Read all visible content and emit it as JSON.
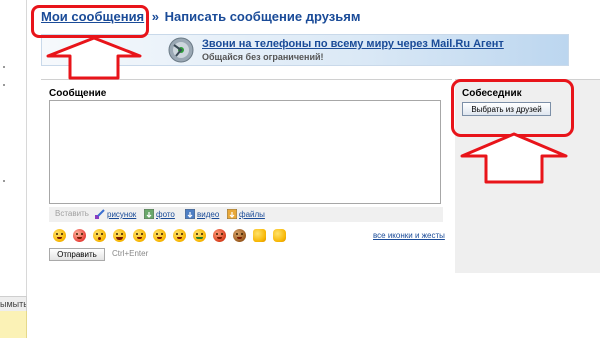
{
  "header": {
    "my_messages": "Мои сообщения",
    "separator": "»",
    "write_message": "Написать сообщение друзьям"
  },
  "banner": {
    "link_text": "Звони на телефоны по всему миру через Mail.Ru Агент",
    "subtitle": "Общайся без ограничений!"
  },
  "compose": {
    "title": "Сообщение",
    "message_value": "",
    "toolbar": {
      "insert_label": "Вставить",
      "drawing": "рисунок",
      "photo": "фото",
      "video": "видео",
      "files": "файлы"
    },
    "all_icons_link": "все иконки и жесты",
    "send_button": "Отправить",
    "hotkey_hint": "Ctrl+Enter"
  },
  "recipient": {
    "title": "Собеседник",
    "pick_button": "Выбрать из друзей"
  },
  "left_sidebar": {
    "tab_label": "ымыть"
  },
  "colors": {
    "link_blue": "#1a4b98",
    "annotation_red": "#e8141a",
    "panel_gray": "#efefef"
  }
}
